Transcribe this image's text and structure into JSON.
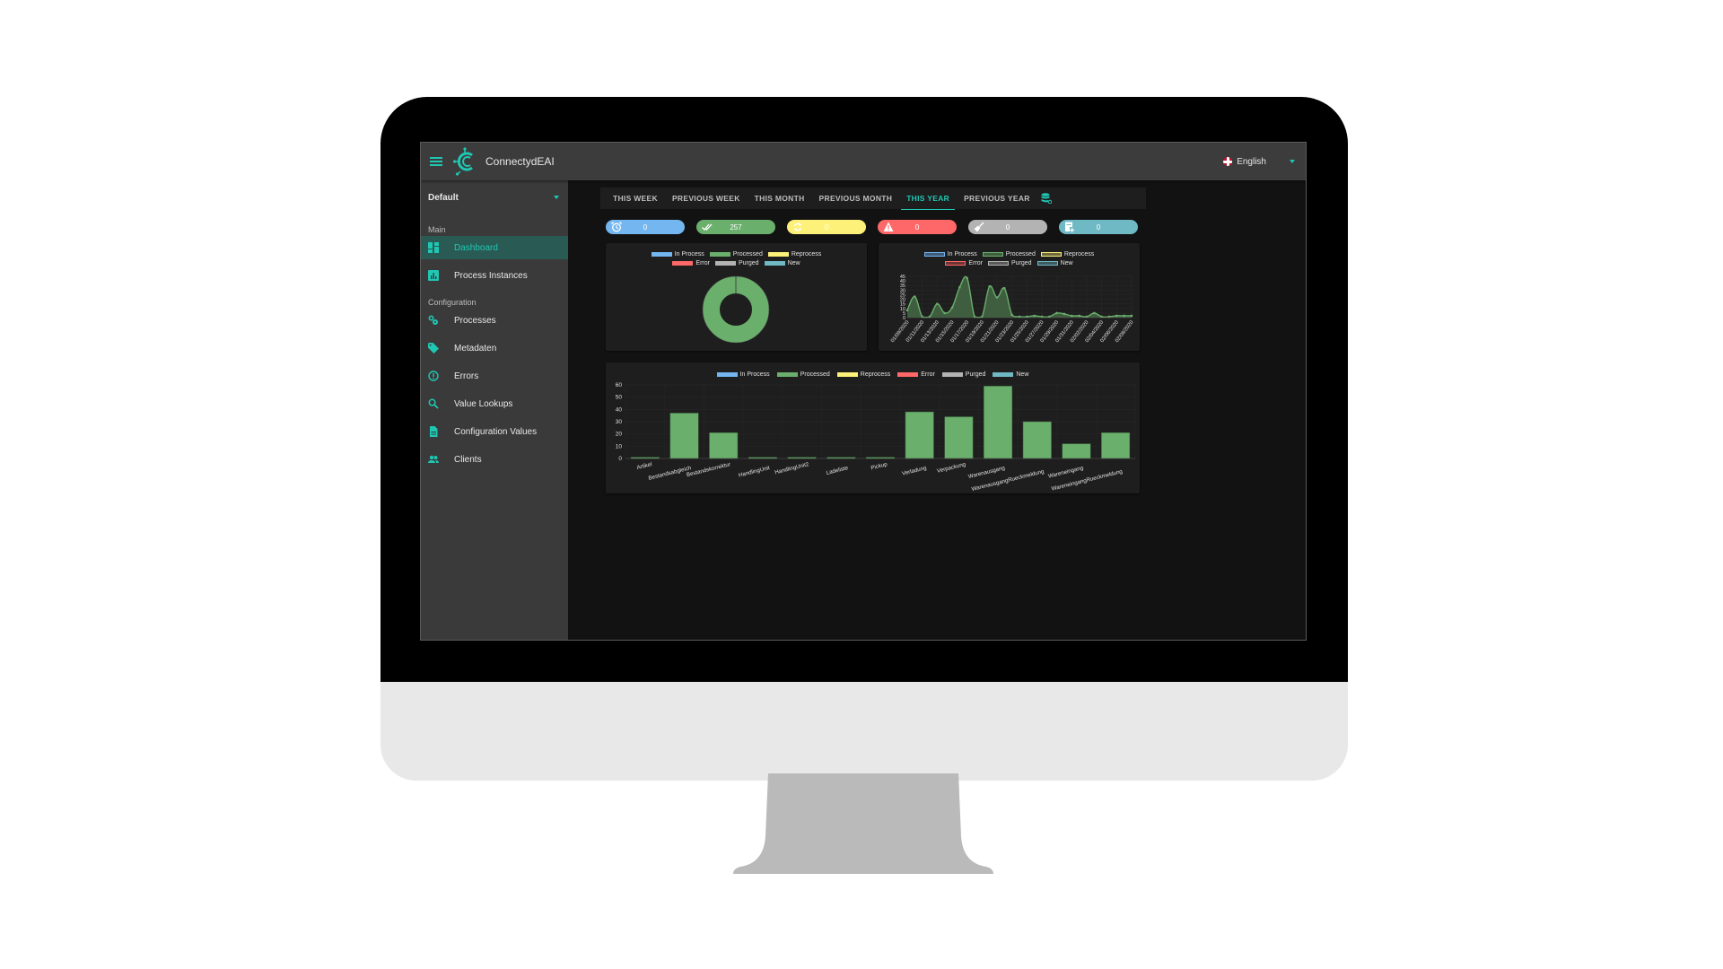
{
  "app": {
    "title": "ConnectydEAI",
    "language": "English"
  },
  "sidebar": {
    "client": "Default",
    "sections": [
      {
        "label": "Main",
        "items": [
          {
            "label": "Dashboard",
            "icon": "dashboard-icon",
            "active": true
          },
          {
            "label": "Process Instances",
            "icon": "bar-chart-icon",
            "active": false
          }
        ]
      },
      {
        "label": "Configuration",
        "items": [
          {
            "label": "Processes",
            "icon": "gears-icon",
            "active": false
          },
          {
            "label": "Metadaten",
            "icon": "tag-icon",
            "active": false
          },
          {
            "label": "Errors",
            "icon": "alert-circle-icon",
            "active": false
          },
          {
            "label": "Value Lookups",
            "icon": "search-icon",
            "active": false
          },
          {
            "label": "Configuration Values",
            "icon": "document-icon",
            "active": false
          },
          {
            "label": "Clients",
            "icon": "people-icon",
            "active": false
          }
        ]
      }
    ]
  },
  "tabs": [
    {
      "label": "THIS WEEK",
      "active": false
    },
    {
      "label": "PREVIOUS WEEK",
      "active": false
    },
    {
      "label": "THIS MONTH",
      "active": false
    },
    {
      "label": "PREVIOUS MONTH",
      "active": false
    },
    {
      "label": "THIS YEAR",
      "active": true
    },
    {
      "label": "PREVIOUS YEAR",
      "active": false
    }
  ],
  "badges": [
    {
      "status": "In Process",
      "value": "0",
      "icon": "alarm-clock-icon",
      "color": "#74b7f0"
    },
    {
      "status": "Processed",
      "value": "257",
      "icon": "double-check-icon",
      "color": "#6aaf6c"
    },
    {
      "status": "Reprocess",
      "value": "0",
      "icon": "refresh-icon",
      "color": "#fef17a"
    },
    {
      "status": "Error",
      "value": "0",
      "icon": "warning-icon",
      "color": "#fe6868"
    },
    {
      "status": "Purged",
      "value": "0",
      "icon": "broom-icon",
      "color": "#b3b3b3"
    },
    {
      "status": "New",
      "value": "0",
      "icon": "note-add-icon",
      "color": "#6fb9c4"
    }
  ],
  "legend": [
    {
      "label": "In Process",
      "color": "#74b7f0"
    },
    {
      "label": "Processed",
      "color": "#6aaf6c"
    },
    {
      "label": "Reprocess",
      "color": "#fef17a"
    },
    {
      "label": "Error",
      "color": "#fe6868"
    },
    {
      "label": "Purged",
      "color": "#b3b3b3"
    },
    {
      "label": "New",
      "color": "#6fb9c4"
    }
  ],
  "chart_data": [
    {
      "type": "pie",
      "title": "",
      "labels": [
        "In Process",
        "Processed",
        "Reprocess",
        "Error",
        "Purged",
        "New"
      ],
      "values": [
        0,
        257,
        0,
        0,
        0,
        0
      ],
      "doughnut": true,
      "legend": "top"
    },
    {
      "type": "area",
      "title": "",
      "legend": "top",
      "x": [
        "01/09/2020",
        "01/10/2020",
        "01/11/2020",
        "01/12/2020",
        "01/13/2020",
        "01/14/2020",
        "01/15/2020",
        "01/16/2020",
        "01/17/2020",
        "01/18/2020",
        "01/19/2020",
        "01/20/2020",
        "01/21/2020",
        "01/22/2020",
        "01/23/2020",
        "01/24/2020",
        "01/25/2020",
        "01/26/2020",
        "01/27/2020",
        "01/28/2020",
        "01/29/2020",
        "01/30/2020",
        "01/31/2020",
        "02/01/2020",
        "02/02/2020",
        "02/03/2020",
        "02/04/2020",
        "02/05/2020",
        "02/06/2020",
        "02/07/2020",
        "02/08/2020"
      ],
      "xtick_labels": [
        "01/09/2020",
        "01/11/2020",
        "01/13/2020",
        "01/15/2020",
        "01/17/2020",
        "01/19/2020",
        "01/21/2020",
        "01/23/2020",
        "01/25/2020",
        "01/27/2020",
        "01/29/2020",
        "01/31/2020",
        "02/02/2020",
        "02/04/2020",
        "02/06/2020",
        "02/08/2020"
      ],
      "series": [
        {
          "name": "Processed",
          "values": [
            8,
            23,
            1,
            1,
            15,
            5,
            11,
            33,
            43,
            1,
            1,
            34,
            22,
            32,
            3,
            1,
            1,
            2,
            1,
            1,
            5,
            4,
            2,
            2,
            1,
            5,
            1,
            1,
            2,
            2,
            2
          ]
        }
      ],
      "ylim": [
        0,
        45
      ],
      "yticks": [
        0,
        5,
        10,
        15,
        20,
        25,
        30,
        35,
        40,
        45
      ],
      "grid": true
    },
    {
      "type": "bar",
      "title": "",
      "legend": "top",
      "categories": [
        "Artikel",
        "Bestandsabgleich",
        "Bestandskorrektur",
        "HandlingUnit",
        "HandlingUnit2",
        "Ladeliste",
        "Pickup",
        "Verladung",
        "Verpackung",
        "Warenausgang",
        "WarenausgangRueckmeldung",
        "Wareneingang",
        "WareneingangRueckmeldung"
      ],
      "series": [
        {
          "name": "Processed",
          "values": [
            1,
            37,
            21,
            1,
            1,
            1,
            1,
            38,
            34,
            59,
            30,
            12,
            21
          ]
        }
      ],
      "ylim": [
        0,
        60
      ],
      "yticks": [
        0,
        10,
        20,
        30,
        40,
        50,
        60
      ],
      "grid": true
    }
  ]
}
